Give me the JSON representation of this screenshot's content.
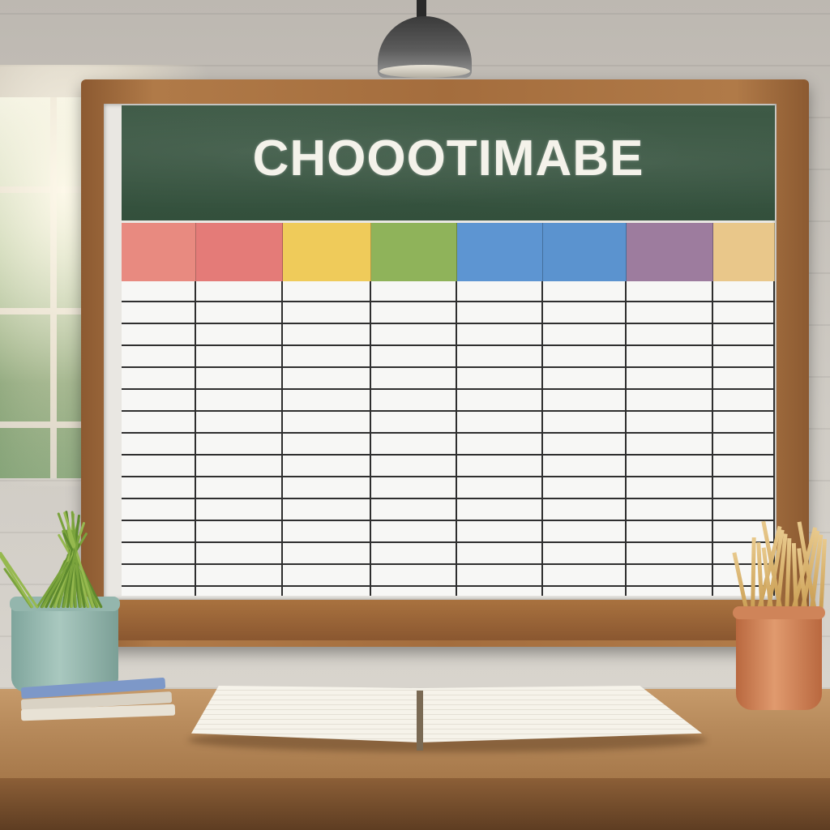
{
  "scene": {
    "board_title": "CHOOOTIMABE",
    "colors": {
      "chalkboard": "#3e5a46",
      "frame": "#a46d3d",
      "desk": "#b78a5b"
    }
  },
  "timetable": {
    "columns": [
      {
        "label": "",
        "color": "#e88a80"
      },
      {
        "label": "",
        "color": "#e47b78"
      },
      {
        "label": "",
        "color": "#efcb5a"
      },
      {
        "label": "",
        "color": "#8fb35a"
      },
      {
        "label": "",
        "color": "#5d95d2"
      },
      {
        "label": "",
        "color": "#5b93cf"
      },
      {
        "label": "",
        "color": "#9d7c9e"
      },
      {
        "label": "",
        "color": "#e9c78a"
      }
    ]
  }
}
